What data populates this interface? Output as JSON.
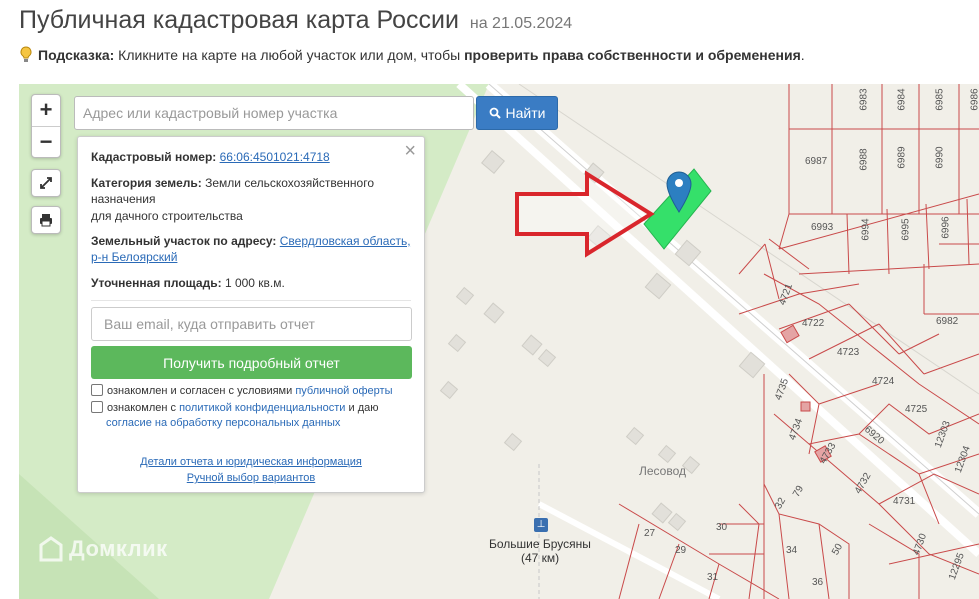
{
  "header": {
    "title": "Публичная кадастровая карта России",
    "date": "на 21.05.2024"
  },
  "hint": {
    "label": "Подсказка:",
    "text": " Кликните на карте на любой участок или дом, чтобы ",
    "bold": "проверить права собственности и обременения",
    "end": "."
  },
  "search": {
    "placeholder": "Адрес или кадастровый номер участка",
    "button_label": "Найти"
  },
  "zoom": {
    "in": "+",
    "out": "−"
  },
  "info": {
    "cadastral_label": "Кадастровый номер:",
    "cadastral_value": "66:06:4501021:4718",
    "category_label": "Категория земель:",
    "category_value": "Земли сельскохозяйственного назначения",
    "category_sub": "для дачного строительства",
    "address_label": "Земельный участок по адресу:",
    "address_value": "Свердловская область, р-н Белоярский",
    "area_label": "Уточненная площадь:",
    "area_value": "1 000 кв.м.",
    "email_placeholder": "Ваш email, куда отправить отчет",
    "report_button": "Получить подробный отчет",
    "consent1_text": "ознакомлен и согласен с условиями ",
    "consent1_link": "публичной оферты",
    "consent2_text": "ознакомлен с ",
    "consent2_link": "политикой конфиденциальности",
    "consent2_mid": " и даю",
    "consent2_link2": "согласие на обработку персональных данных",
    "details_link": "Детали отчета и юридическая информация",
    "manual_link": "Ручной выбор вариантов",
    "close": "×"
  },
  "map": {
    "place_label": "Лесовод",
    "station_name": "Большие Брусяны",
    "station_km": "(47 км)",
    "watermark": "Домклик",
    "parcel_labels": [
      "6983",
      "6984",
      "6985",
      "6986",
      "6987",
      "6988",
      "6989",
      "6990",
      "6993",
      "6994",
      "6995",
      "6996",
      "6982",
      "4721",
      "4722",
      "4723",
      "4724",
      "4725",
      "4735",
      "4734",
      "4733",
      "4732",
      "4731",
      "4730",
      "6920",
      "12303",
      "12304",
      "12295",
      "79",
      "32",
      "30",
      "27",
      "29",
      "31",
      "34",
      "36",
      "50"
    ]
  },
  "colors": {
    "accent": "#3a7cc4",
    "success": "#5cb85c",
    "parcel": "#c94a4a",
    "selected": "#35e06a",
    "arrow": "#d9262c",
    "marker": "#2c7fc1"
  }
}
